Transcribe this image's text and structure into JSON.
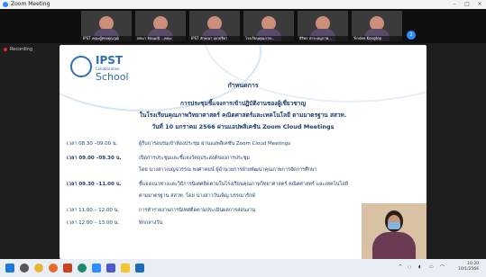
{
  "window": {
    "title": "Zoom Meeting",
    "minimize": "–",
    "maximize": "□",
    "close": "×"
  },
  "participants": [
    {
      "name": "IPST คณะผู้ทรงคุณวุฒิ"
    },
    {
      "name": "พจนา รัตนมณี ...คณะ"
    },
    {
      "name": "IPST ลักษณา เอกปรีดา"
    },
    {
      "name": "โรงเรียนคุณภาพ..."
    },
    {
      "name": "สิริพร สาระอนุภาพ..."
    },
    {
      "name": "Yindee Kongtep"
    },
    {
      "name": ""
    }
  ],
  "more_button": "2",
  "recording": "Recording",
  "slide": {
    "logo": {
      "ipst": "IPST",
      "collab": "Collaborative",
      "school": "School"
    },
    "agenda_title": "กำหนดการ",
    "heading1": "การประชุมชี้แจงการเข้าปฏิบัติงานของผู้เชี่ยวชาญ",
    "heading2": "ในโรงเรียนคุณภาพวิทยาศาสตร์ คณิตศาสตร์และเทคโนโลยี ตามมาตรฐาน สสวท.",
    "heading3": "วันที่ 10 มกราคม 2566 ผ่านแอปพลิเคชัน Zoom Cloud Meetings",
    "rows": [
      {
        "time": "เวลา 08.30 –09.00 น.",
        "text": "ผู้รับการอบรมเข้าห้องประชุม ผ่านแอพลิเคชัน Zoom Cloud Meetings"
      },
      {
        "time": "เวลา 09.00 –09.30 น.",
        "text": "เปิดการประชุมและชี้แจงวัตถุประสงค์ของการประชุม"
      },
      {
        "time": "",
        "text": "โดย นางสาวเบญจวรรณ พงศาคมน์ ผู้อำนวยการฝ่ายพัฒนาคุณภาพการจัดการศึกษา"
      },
      {
        "time": "เวลา 09.30 –11.00 น.",
        "text": "ชี้แจงแนวทางและวิธีการนิเทศติดตามในโรงเรียนคุณภาพวิทยาศาสตร์ คณิตศาสตร์ และเทคโนโลยี"
      },
      {
        "time": "",
        "text": "ตามมาตรฐาน สสวท. โดย นางสาววันเพ็ญ บรรณารักษ์"
      },
      {
        "time": "เวลา 11.00 – 12.00 น.",
        "text": "การทำรายงานการนิเทศติดตามประเมินผลการสอนงาน"
      },
      {
        "time": "เวลา 12.00 – 13.00 น.",
        "text": "พักกลางวัน"
      }
    ]
  },
  "taskbar": {
    "clock_time": "10:20",
    "clock_date": "10/1/2566",
    "icons": [
      "windows-icon",
      "search-icon",
      "chrome-icon",
      "firefox-icon",
      "powerpoint-icon",
      "edge-icon",
      "zoom-icon",
      "teams-icon",
      "explorer-icon",
      "app-icon"
    ]
  }
}
